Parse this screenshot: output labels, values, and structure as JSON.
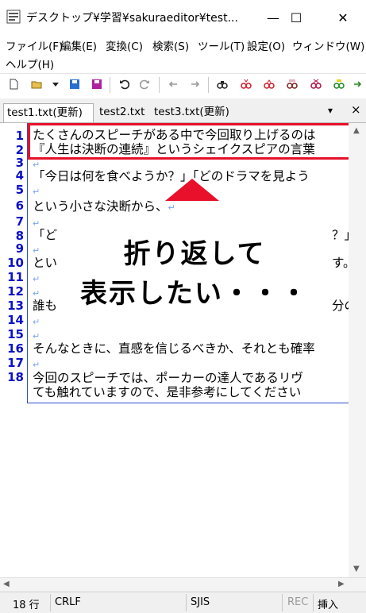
{
  "window": {
    "title": "デスクトップ¥学習¥sakuraeditor¥test...",
    "minimize": "—",
    "maximize": "☐",
    "close": "✕"
  },
  "menu": [
    "ファイル(F)",
    "編集(E)",
    "変換(C)",
    "検索(S)",
    "ツール(T)",
    "設定(O)",
    "ウィンドウ(W)",
    "ヘルプ(H)"
  ],
  "tabs": [
    {
      "label": "test1.txt(更新)",
      "active": true
    },
    {
      "label": "test2.txt",
      "active": false
    },
    {
      "label": "test3.txt(更新)",
      "active": false
    }
  ],
  "tab_controls": {
    "dropdown": "▾",
    "close": "×"
  },
  "editor": {
    "line_numbers": [
      "1",
      "2",
      "3",
      "4",
      "5",
      "6",
      "7",
      "8",
      "9",
      "10",
      "11",
      "12",
      "13",
      "14",
      "15",
      "16",
      "17",
      "18"
    ],
    "lines": [
      "たくさんのスピーチがある中で今回取り上げるのは",
      "『人生は決断の連続』というシェイクスピアの言葉",
      "",
      "「今日は何を食べようか？」「どのドラマを見よう",
      "",
      "という小さな決断から、",
      "",
      "「ど",
      "",
      "とい",
      "",
      "",
      "誰も",
      "",
      "",
      "そんなときに、直感を信じるべきか、それとも確率",
      "",
      "今回のスピーチでは、ポーカーの達人であるリヴ",
      "ても触れていますので、是非参考にしてください"
    ],
    "right_fragments": {
      "line8": "？」",
      "line10": "す。",
      "line13": "分の"
    },
    "eol_mark": "↵"
  },
  "annotation": {
    "line1": "折り返して",
    "line2": "表示したい・・・"
  },
  "status": {
    "line": "18 行",
    "eol": "CRLF",
    "encoding": "SJIS",
    "rec": "REC",
    "mode": "挿入"
  },
  "colors": {
    "line_number": "#0a10c8",
    "highlight": "#e8102a",
    "eol": "#7aa3f0"
  }
}
